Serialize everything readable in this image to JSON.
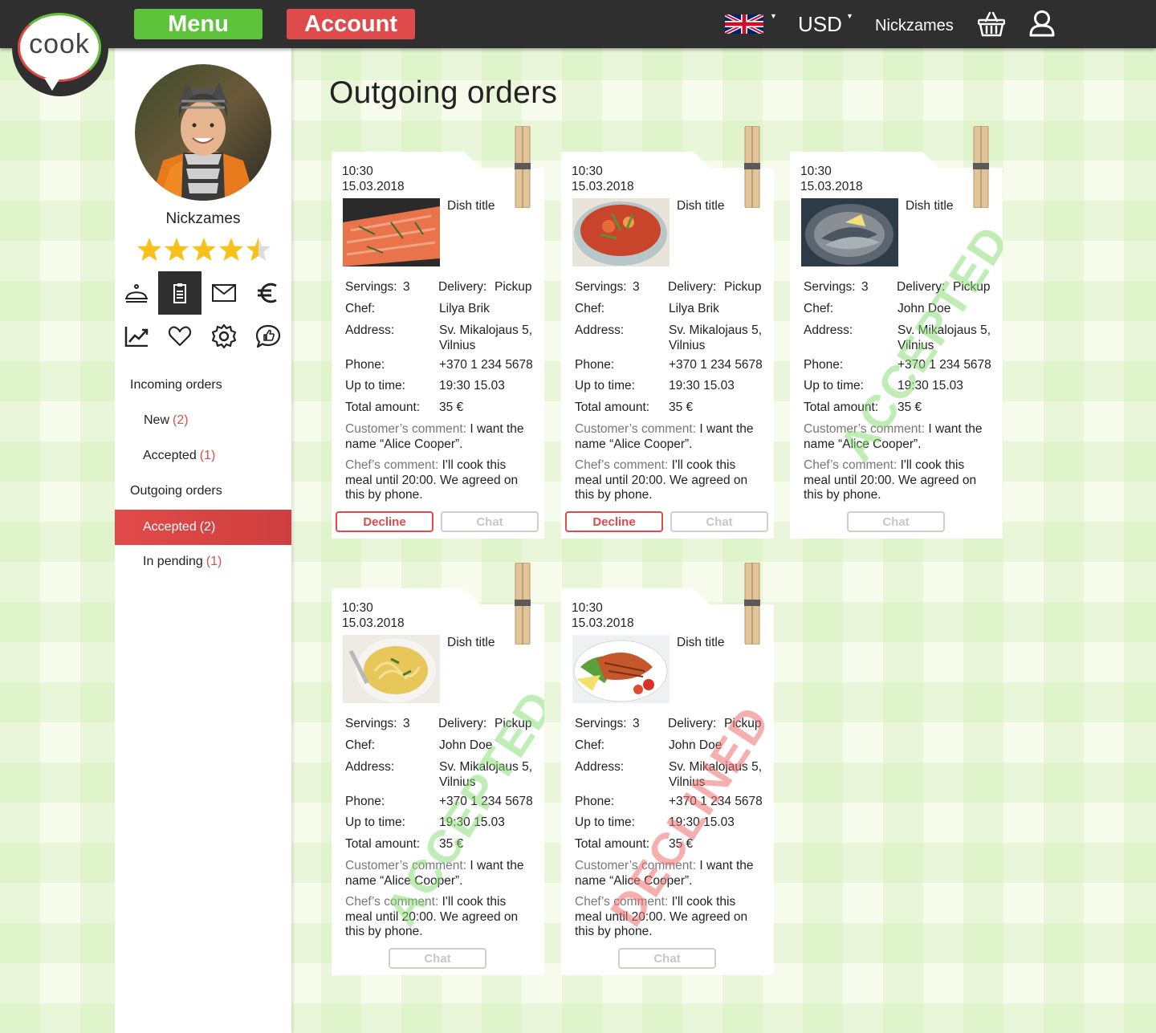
{
  "header": {
    "logo_text": "cook",
    "menu_label": "Menu",
    "account_label": "Account",
    "language_flag": "uk-flag-icon",
    "currency": "USD",
    "username": "Nickzames",
    "basket_icon": "basket-icon",
    "profile_icon": "user-icon"
  },
  "colors": {
    "green": "#5cc33b",
    "red": "#df4b4b",
    "dark": "#2f2f2f",
    "star": "#f7c11a"
  },
  "sidebar": {
    "profile_name": "Nickzames",
    "rating": 4.5,
    "rating_max": 5,
    "icons": [
      "dish-cloche-icon",
      "orders-document-icon",
      "mail-icon",
      "euro-icon",
      "stats-chart-icon",
      "heart-icon",
      "gear-icon",
      "chat-like-icon"
    ],
    "nav": [
      {
        "label": "Incoming orders",
        "count": ""
      },
      {
        "label": "New",
        "count": "(2)"
      },
      {
        "label": "Accepted",
        "count": "(1)"
      },
      {
        "label": "Outgoing orders",
        "count": ""
      },
      {
        "label": "Accepted",
        "count": "(2)"
      },
      {
        "label": "In pending",
        "count": "(1)"
      }
    ]
  },
  "page_title": "Outgoing orders",
  "labels": {
    "servings": "Servings:",
    "delivery": "Delivery:",
    "chef": "Chef:",
    "address": "Address:",
    "phone": "Phone:",
    "up_to_time": "Up to time:",
    "total_amount": "Total amount:",
    "customer_comment": "Customer’s comment:",
    "chef_comment": "Chef’s comment:",
    "decline": "Decline",
    "chat": "Chat",
    "accepted_stamp": "ACCEPTED",
    "declined_stamp": "DECLINED"
  },
  "orders": [
    {
      "time": "10:30",
      "date": "15.03.2018",
      "dish": "Dish title",
      "image": "salmon-photo",
      "servings": "3",
      "delivery": "Pickup",
      "chef": "Lilya Brik",
      "address_line1": "Sv. Mikalojaus 5,",
      "address_line2": "Vilnius",
      "phone": "+370 1 234 5678",
      "up_to": "19:30 15.03",
      "total": "35 €",
      "customer_comment": "I want the name “Alice Cooper”.",
      "chef_comment": "I'll cook this meal until 20:00. We agreed on this by phone.",
      "status": ""
    },
    {
      "time": "10:30",
      "date": "15.03.2018",
      "dish": "Dish title",
      "image": "soup-photo",
      "servings": "3",
      "delivery": "Pickup",
      "chef": "Lilya Brik",
      "address_line1": "Sv. Mikalojaus 5,",
      "address_line2": "Vilnius",
      "phone": "+370 1 234 5678",
      "up_to": "19:30 15.03",
      "total": "35 €",
      "customer_comment": "I want the name “Alice Cooper”.",
      "chef_comment": "I'll cook this meal until 20:00. We agreed on this by phone.",
      "status": ""
    },
    {
      "time": "10:30",
      "date": "15.03.2018",
      "dish": "Dish title",
      "image": "sardines-photo",
      "servings": "3",
      "delivery": "Pickup",
      "chef": "John Doe",
      "address_line1": "Sv. Mikalojaus 5,",
      "address_line2": "Vilnius",
      "phone": "+370 1 234 5678",
      "up_to": "19:30 15.03",
      "total": "35 €",
      "customer_comment": "I want the name “Alice Cooper”.",
      "chef_comment": "I'll cook this meal until 20:00. We agreed on this by phone.",
      "status": "accepted"
    },
    {
      "time": "10:30",
      "date": "15.03.2018",
      "dish": "Dish title",
      "image": "noodle-soup-photo",
      "servings": "3",
      "delivery": "Pickup",
      "chef": "John Doe",
      "address_line1": "Sv. Mikalojaus 5,",
      "address_line2": "Vilnius",
      "phone": "+370 1 234 5678",
      "up_to": "19:30 15.03",
      "total": "35 €",
      "customer_comment": "I want the name “Alice Cooper”.",
      "chef_comment": "I'll cook this meal until 20:00. We agreed on this by phone.",
      "status": "accepted"
    },
    {
      "time": "10:30",
      "date": "15.03.2018",
      "dish": "Dish title",
      "image": "grilled-salmon-photo",
      "servings": "3",
      "delivery": "Pickup",
      "chef": "John Doe",
      "address_line1": "Sv. Mikalojaus 5,",
      "address_line2": "Vilnius",
      "phone": "+370 1 234 5678",
      "up_to": "19:30 15.03",
      "total": "35 €",
      "customer_comment": "I want the name “Alice Cooper”.",
      "chef_comment": "I'll cook this meal until 20:00. We agreed on this by phone.",
      "status": "declined"
    }
  ]
}
